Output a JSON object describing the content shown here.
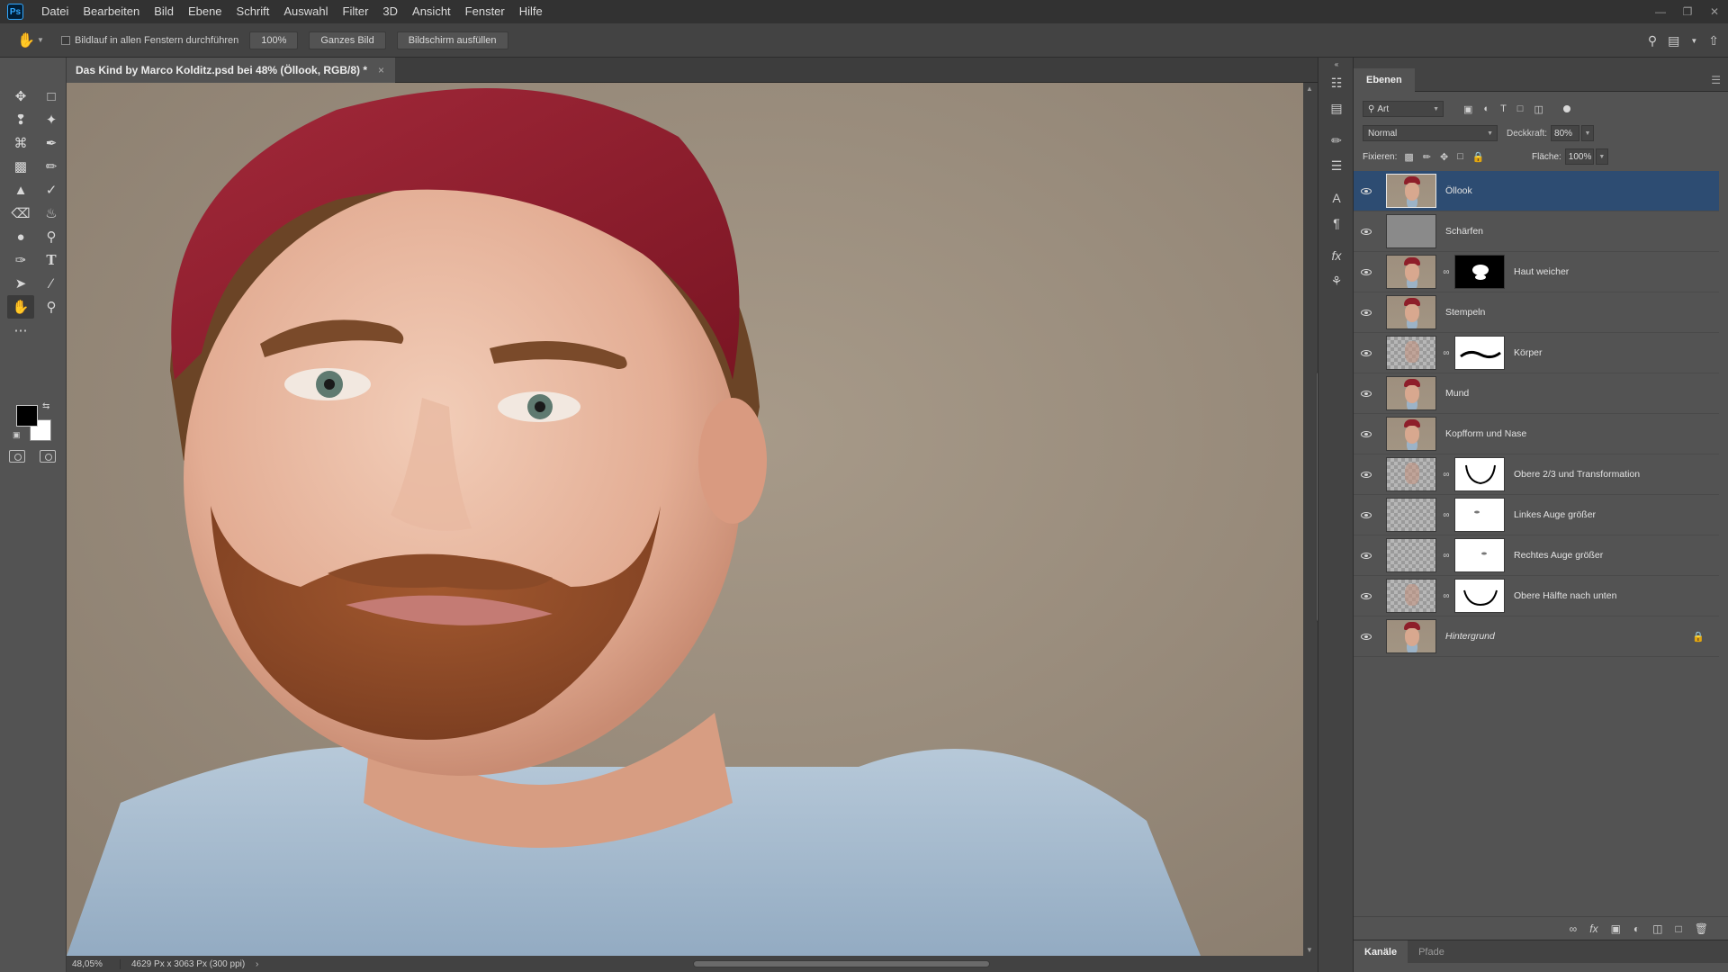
{
  "menubar": {
    "logo": "Ps",
    "items": [
      "Datei",
      "Bearbeiten",
      "Bild",
      "Ebene",
      "Schrift",
      "Auswahl",
      "Filter",
      "3D",
      "Ansicht",
      "Fenster",
      "Hilfe"
    ]
  },
  "options": {
    "scroll_all_label": "Bildlauf in allen Fenstern durchführen",
    "zoom_btn": "100%",
    "fit_btn": "Ganzes Bild",
    "fill_btn": "Bildschirm ausfüllen"
  },
  "document": {
    "tab_title": "Das Kind by Marco Kolditz.psd bei 48% (Öllook, RGB/8) *",
    "close": "×"
  },
  "status": {
    "zoom": "48,05%",
    "info": "4629 Px x 3063 Px (300 ppi)"
  },
  "layers_panel": {
    "tab": "Ebenen",
    "filter_kind": "Art",
    "blend_mode": "Normal",
    "opacity_label": "Deckkraft:",
    "opacity": "80%",
    "lock_label": "Fixieren:",
    "fill_label": "Fläche:",
    "fill": "100%",
    "layers": [
      {
        "name": "Öllook",
        "thumb": "face",
        "mask": null,
        "selected": true
      },
      {
        "name": "Schärfen",
        "thumb": "gray",
        "mask": null,
        "selected": false
      },
      {
        "name": "Haut weicher",
        "thumb": "face",
        "mask": "black",
        "selected": false
      },
      {
        "name": "Stempeln",
        "thumb": "face",
        "mask": null,
        "selected": false
      },
      {
        "name": "Körper",
        "thumb": "checker-face",
        "mask": "white-curve",
        "selected": false
      },
      {
        "name": "Mund",
        "thumb": "face",
        "mask": null,
        "selected": false
      },
      {
        "name": "Kopfform und Nase",
        "thumb": "face",
        "mask": null,
        "selected": false
      },
      {
        "name": "Obere 2/3 und Transformation",
        "thumb": "checker-face",
        "mask": "white-jaw",
        "selected": false
      },
      {
        "name": "Linkes Auge größer",
        "thumb": "checker",
        "mask": "white-dot",
        "selected": false
      },
      {
        "name": "Rechtes Auge größer",
        "thumb": "checker",
        "mask": "white-dot",
        "selected": false
      },
      {
        "name": "Obere Hälfte nach unten",
        "thumb": "checker-face",
        "mask": "white-jaw",
        "selected": false
      },
      {
        "name": "Hintergrund",
        "thumb": "face",
        "mask": null,
        "selected": false,
        "locked": true
      }
    ]
  },
  "bottom_tabs": [
    "Kanäle",
    "Pfade"
  ],
  "colors": {
    "selection": "#2d4c72",
    "ps_blue": "#31a8ff",
    "beanie": "#8e1e2a",
    "backdrop": "#9c8f7f"
  }
}
